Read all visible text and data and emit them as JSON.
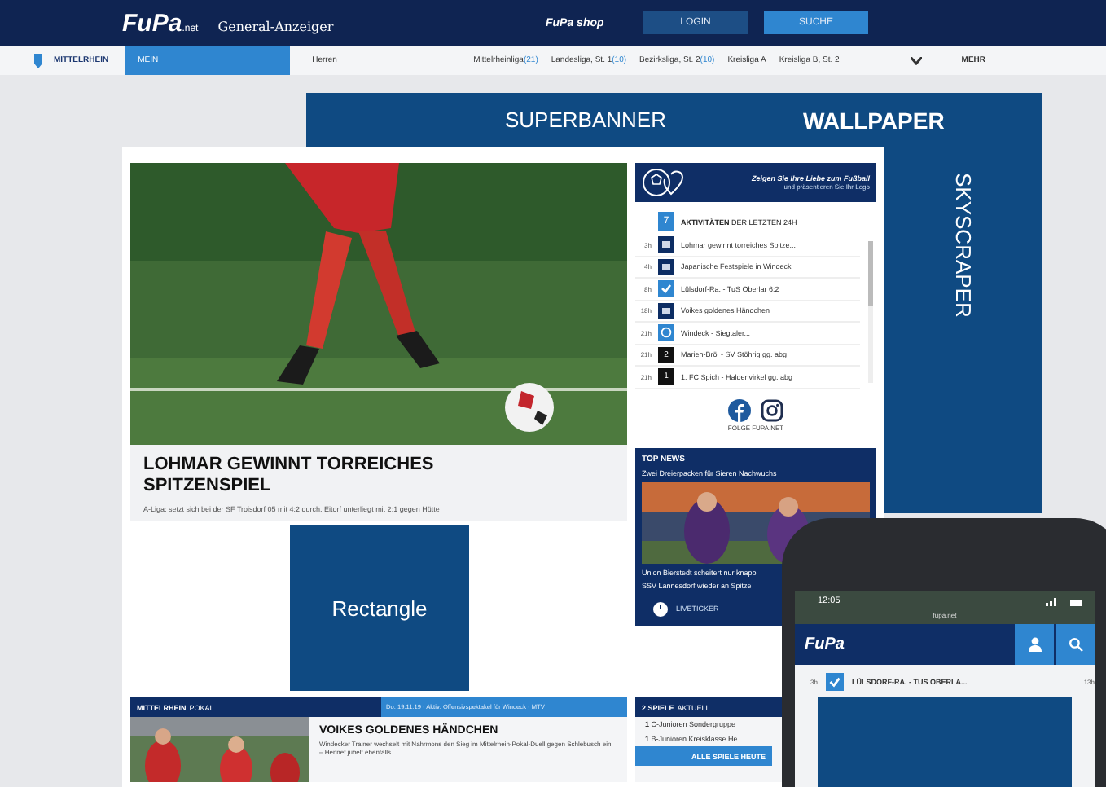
{
  "header": {
    "logo": "FuPa",
    "logo_suffix": ".net",
    "partner": "General-Anzeiger",
    "shop": "FuPa shop",
    "buttons": [
      {
        "label": "LOGIN",
        "kind": "login"
      },
      {
        "label": "SUCHE",
        "kind": "search"
      }
    ]
  },
  "nav": {
    "region": "MITTELRHEIN",
    "tabs": [
      {
        "label": "MEIN",
        "selected": true
      },
      {
        "label": "Herren",
        "selected": false
      }
    ],
    "leagues": [
      {
        "name": "Mittelrheinliga",
        "count": "(21)"
      },
      {
        "name": "Landesliga, St. 1",
        "count": "(10)"
      },
      {
        "name": "Bezirksliga, St. 2",
        "count": "(10)"
      },
      {
        "name": "Kreisliga A"
      },
      {
        "name": "Kreisliga B, St. 2"
      }
    ],
    "more": "MEHR"
  },
  "ads": [
    {
      "kind": "superbanner",
      "label": "SUPERBANNER"
    },
    {
      "kind": "wallpaper",
      "label": "WALLPAPER"
    },
    {
      "kind": "skyscraper",
      "label": "SKYSCRAPER"
    },
    {
      "kind": "rectangle",
      "label": "Rectangle"
    }
  ],
  "article": {
    "headline": "LOHMAR GEWINNT TORREICHES SPITZENSPIEL",
    "teaser": "A-Liga: setzt sich bei der SF Troisdorf 05 mit 4:2 durch. Eitorf unterliegt mit 2:1 gegen Hütte"
  },
  "promo": {
    "line1": "Zeigen Sie Ihre Liebe zum Fußball",
    "line2": "und präsentieren Sie Ihr Logo"
  },
  "activity": {
    "count": "7",
    "title_bold": "AKTIVITÄTEN",
    "title": "DER LETZTEN 24H",
    "follow": "FOLGE FUPA.NET",
    "items": [
      {
        "time": "3h",
        "kind": "article",
        "text": "Lohmar gewinnt torreiches Spitze..."
      },
      {
        "time": "4h",
        "kind": "article",
        "text": "Japanische Festspiele in Windeck"
      },
      {
        "time": "8h",
        "kind": "check",
        "text": "Lülsdorf-Ra. - TuS Oberlar 6:2"
      },
      {
        "time": "18h",
        "kind": "article",
        "text": "Voikes goldenes Händchen"
      },
      {
        "time": "21h",
        "kind": "live",
        "text": "Windeck - Siegtaler..."
      },
      {
        "time": "21h",
        "kind": "rank",
        "badge": "2",
        "text": "Marien-Bröl - SV Stöhrig gg. abg"
      },
      {
        "time": "21h",
        "kind": "rank",
        "badge": "1",
        "text": "1. FC Spich - Haldenvirkel gg. abg"
      }
    ]
  },
  "topnews": {
    "title": "TOP NEWS",
    "items": [
      {
        "text": "Zwei Dreierpacken für Sieren Nachwuchs"
      },
      {
        "text": "Union Bierstedt scheitert nur knapp"
      },
      {
        "text": "SSV Lannesdorf wieder an Spitze"
      }
    ],
    "liveticker": "LIVETICKER"
  },
  "pokal": {
    "title_bold": "MITTELRHEIN",
    "title": "POKAL",
    "info": "Do. 19.11.19 · Aktiv: Offensivspektakel für Windeck · MTV",
    "headline": "VOIKES GOLDENES HÄNDCHEN",
    "teaser": "Windecker Trainer wechselt mit Nahrmons den Sieg im Mittelrhein-Pokal-Duell gegen Schlebusch ein – Hennef jubelt ebenfalls"
  },
  "games": {
    "title_bold": "2 SPIELE",
    "title": "AKTUELL",
    "items": [
      {
        "count": "1",
        "text": "C-Junioren Sondergruppe"
      },
      {
        "count": "1",
        "text": "B-Junioren Kreisklasse He"
      }
    ],
    "button": "ALLE SPIELE HEUTE"
  },
  "phone": {
    "time": "12:05",
    "url": "fupa.net",
    "logo": "FuPa",
    "row": {
      "time": "3h",
      "text": "LÜLSDORF-RA. - TUS OBERLA...",
      "time2": "13h"
    }
  }
}
